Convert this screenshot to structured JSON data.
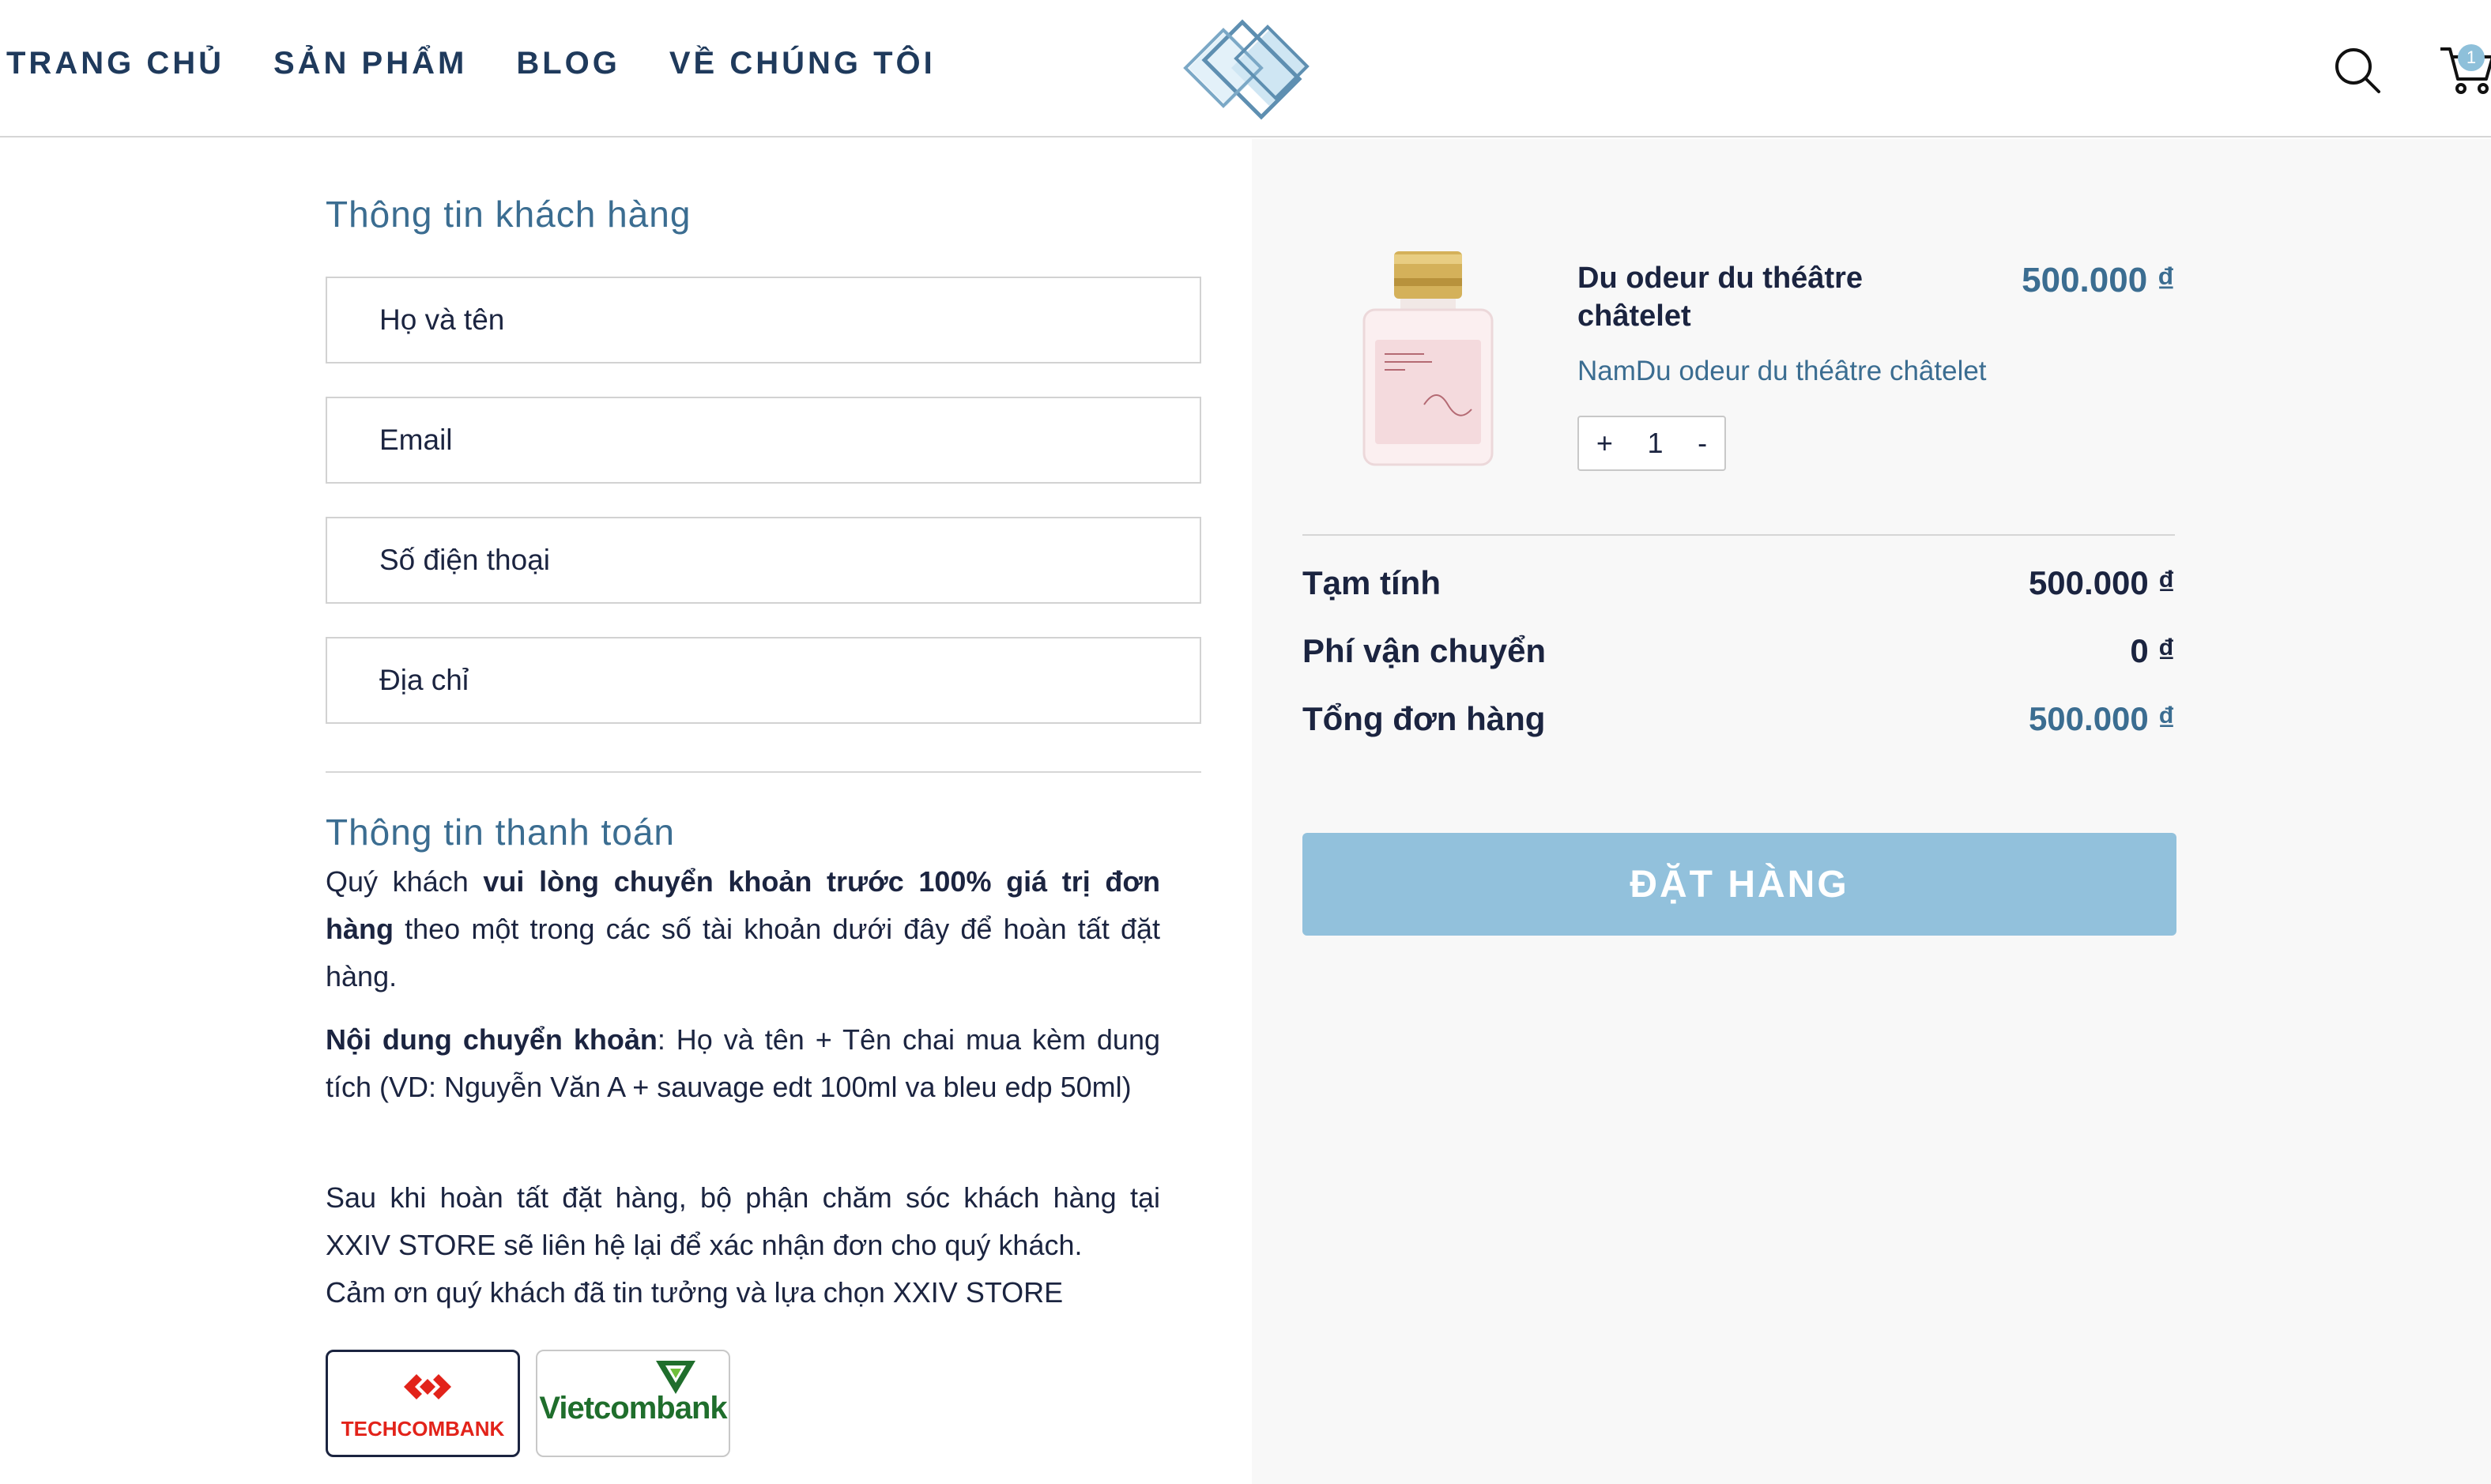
{
  "nav": {
    "items": [
      {
        "label": "TRANG CHỦ"
      },
      {
        "label": "SẢN PHẨM"
      },
      {
        "label": "BLOG"
      },
      {
        "label": "VỀ CHÚNG TÔI"
      }
    ]
  },
  "cart": {
    "count": "1"
  },
  "customer": {
    "title": "Thông tin khách hàng",
    "fields": [
      {
        "placeholder": "Họ và tên",
        "value": ""
      },
      {
        "placeholder": "Email",
        "value": ""
      },
      {
        "placeholder": "Số điện thoại",
        "value": ""
      },
      {
        "placeholder": "Địa chỉ",
        "value": ""
      }
    ]
  },
  "payment": {
    "title": "Thông tin thanh toán",
    "p1_a": "Quý khách ",
    "p1_b": "vui lòng chuyển khoản trước 100% giá trị đơn hàng",
    "p1_c": " theo một trong các số tài khoản dưới đây để hoàn tất đặt hàng.",
    "p2_a": "Nội dung chuyển khoản",
    "p2_b": ": Họ và tên + Tên chai mua kèm dung tích (VD: Nguyễn Văn A + sauvage edt 100ml va bleu edp 50ml)",
    "p3_a": "Sau khi hoàn tất đặt hàng, bộ phận chăm sóc khách hàng tại XXIV STORE sẽ liên hệ lại để xác nhận đơn cho quý khách.",
    "p3_b": "Cảm ơn quý khách đã tin tưởng và lựa chọn XXIV STORE",
    "banks": [
      {
        "name": "TECHCOMBANK"
      },
      {
        "name": "Vietcombank"
      }
    ]
  },
  "order": {
    "product": {
      "name": "Du odeur du théâtre châtelet",
      "price": "500.000 ₫",
      "variant": "NamDu odeur du théâtre châtelet",
      "qty_plus": "+",
      "qty": "1",
      "qty_minus": "-"
    },
    "subtotal_label": "Tạm tính",
    "subtotal_value": "500.000 ₫",
    "shipping_label": "Phí vận chuyển",
    "shipping_value": "0 ₫",
    "total_label": "Tổng đơn hàng",
    "total_value": "500.000 ₫",
    "submit_label": "ĐẶT HÀNG"
  },
  "colors": {
    "accent": "#3b6d91",
    "button": "#92c1dc",
    "text": "#1b2440",
    "panel": "#f8f8f8"
  }
}
